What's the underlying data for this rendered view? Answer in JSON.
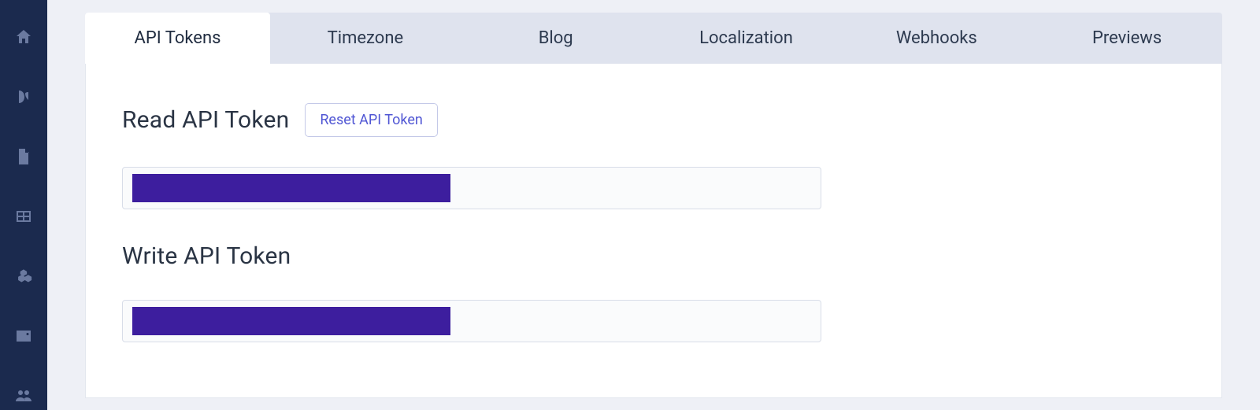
{
  "tabs": [
    {
      "label": "API Tokens",
      "active": true
    },
    {
      "label": "Timezone",
      "active": false
    },
    {
      "label": "Blog",
      "active": false
    },
    {
      "label": "Localization",
      "active": false
    },
    {
      "label": "Webhooks",
      "active": false
    },
    {
      "label": "Previews",
      "active": false
    }
  ],
  "sections": {
    "read": {
      "title": "Read API Token",
      "reset_label": "Reset API Token"
    },
    "write": {
      "title": "Write API Token"
    }
  },
  "sidebar": {
    "items": [
      {
        "name": "home-icon"
      },
      {
        "name": "blog-icon"
      },
      {
        "name": "page-icon"
      },
      {
        "name": "grid-icon"
      },
      {
        "name": "cubes-icon"
      },
      {
        "name": "image-icon"
      },
      {
        "name": "users-icon"
      }
    ]
  }
}
